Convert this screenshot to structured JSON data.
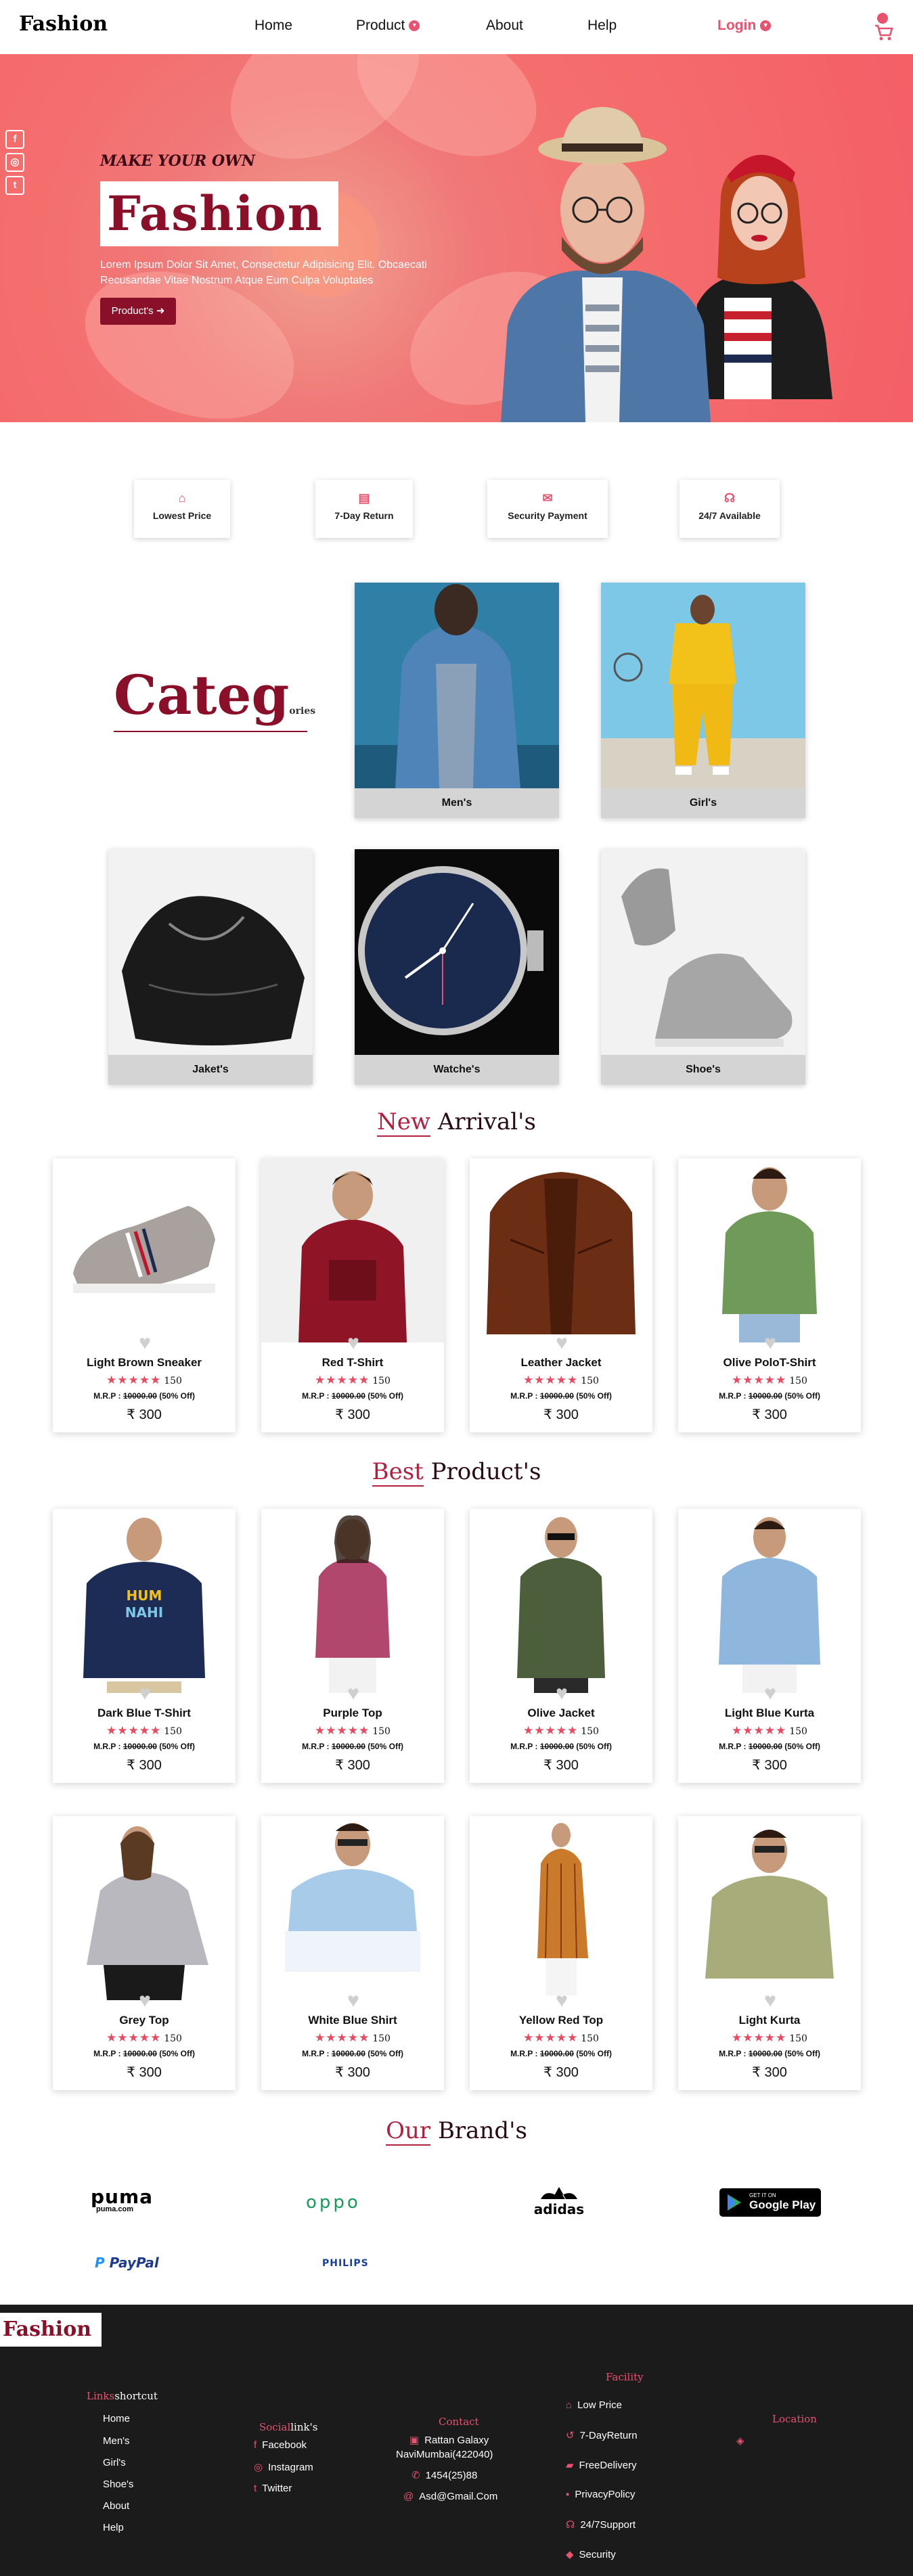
{
  "nav": {
    "logo": "Fashion",
    "items": [
      "Home",
      "Product",
      "About",
      "Help"
    ],
    "login": "Login"
  },
  "hero": {
    "tagline": "MAKE YOUR OWN",
    "title": "Fashion",
    "description": "Lorem Ipsum Dolor Sit Amet, Consectetur Adipisicing Elit. Obcaecati Recusandae Vitae Nostrum Atque Eum Culpa Voluptates",
    "button": "Product's",
    "social": [
      "facebook-icon",
      "instagram-icon",
      "twitter-icon"
    ]
  },
  "features": [
    "Lowest Price",
    "7-Day Return",
    "Security Payment",
    "24/7 Available"
  ],
  "categories": {
    "title_big": "Categ",
    "title_small": "ories",
    "items": [
      "Men's",
      "Girl's",
      "Jaket's",
      "Watche's",
      "Shoe's"
    ]
  },
  "new_arrivals": {
    "accent": "New",
    "rest": "Arrival's",
    "items": [
      {
        "name": "Light Brown Sneaker",
        "stars": "★★★★★",
        "count": "150",
        "mrp_label": "M.R.P :",
        "mrp": "10000.00",
        "off": "(50% Off)",
        "price": "300"
      },
      {
        "name": "Red T-Shirt",
        "stars": "★★★★★",
        "count": "150",
        "mrp_label": "M.R.P :",
        "mrp": "10000.00",
        "off": "(50% Off)",
        "price": "300"
      },
      {
        "name": "Leather Jacket",
        "stars": "★★★★★",
        "count": "150",
        "mrp_label": "M.R.P :",
        "mrp": "10000.00",
        "off": "(50% Off)",
        "price": "300"
      },
      {
        "name": "Olive PoloT-Shirt",
        "stars": "★★★★★",
        "count": "150",
        "mrp_label": "M.R.P :",
        "mrp": "10000.00",
        "off": "(50% Off)",
        "price": "300"
      }
    ]
  },
  "best_products": {
    "accent": "Best",
    "rest": "Product's",
    "items": [
      {
        "name": "Dark Blue T-Shirt",
        "stars": "★★★★★",
        "count": "150",
        "mrp_label": "M.R.P :",
        "mrp": "10000.00",
        "off": "(50% Off)",
        "price": "300",
        "print": "HUM NAHI SUDHRENGE"
      },
      {
        "name": "Purple Top",
        "stars": "★★★★★",
        "count": "150",
        "mrp_label": "M.R.P :",
        "mrp": "10000.00",
        "off": "(50% Off)",
        "price": "300"
      },
      {
        "name": "Olive Jacket",
        "stars": "★★★★★",
        "count": "150",
        "mrp_label": "M.R.P :",
        "mrp": "10000.00",
        "off": "(50% Off)",
        "price": "300"
      },
      {
        "name": "Light Blue Kurta",
        "stars": "★★★★★",
        "count": "150",
        "mrp_label": "M.R.P :",
        "mrp": "10000.00",
        "off": "(50% Off)",
        "price": "300"
      },
      {
        "name": "Grey Top",
        "stars": "★★★★★",
        "count": "150",
        "mrp_label": "M.R.P :",
        "mrp": "10000.00",
        "off": "(50% Off)",
        "price": "300"
      },
      {
        "name": "White Blue Shirt",
        "stars": "★★★★★",
        "count": "150",
        "mrp_label": "M.R.P :",
        "mrp": "10000.00",
        "off": "(50% Off)",
        "price": "300"
      },
      {
        "name": "Yellow Red Top",
        "stars": "★★★★★",
        "count": "150",
        "mrp_label": "M.R.P :",
        "mrp": "10000.00",
        "off": "(50% Off)",
        "price": "300"
      },
      {
        "name": "Light Kurta",
        "stars": "★★★★★",
        "count": "150",
        "mrp_label": "M.R.P :",
        "mrp": "10000.00",
        "off": "(50% Off)",
        "price": "300"
      }
    ]
  },
  "currency": "₹",
  "brands": {
    "accent": "Our",
    "rest": "Brand's",
    "puma": "puma",
    "puma_url": "puma.com",
    "oppo": "oppo",
    "adidas": "adidas",
    "gplay_small": "GET IT ON",
    "gplay": "Google Play",
    "paypal": "PayPal",
    "philips": "PHILIPS"
  },
  "footer": {
    "logo": "Fashion",
    "links": {
      "head_accent": "Links",
      "head_rest": "shortcut",
      "items": [
        "Home",
        "Men's",
        "Girl's",
        "Shoe's",
        "About",
        "Help"
      ]
    },
    "social": {
      "head_accent": "Social",
      "head_rest": "link's",
      "items": [
        "Facebook",
        "Instagram",
        "Twitter"
      ]
    },
    "contact": {
      "head": "Contact",
      "address_line1": "Rattan Galaxy",
      "address_line2": "NaviMumbai(422040)",
      "phone": "1454(25)88",
      "email": "Asd@Gmail.Com"
    },
    "facility": {
      "head": "Facility",
      "items": [
        "Low Price",
        "7-DayReturn",
        "FreeDelivery",
        "PrivacyPolicy",
        "24/7Support",
        "Security"
      ]
    },
    "location": {
      "head": "Location"
    }
  },
  "colors": {
    "accent": "#e8526f",
    "brand": "#8a0f28",
    "hero": "#f46a6a",
    "footer": "#1b1b1b"
  }
}
